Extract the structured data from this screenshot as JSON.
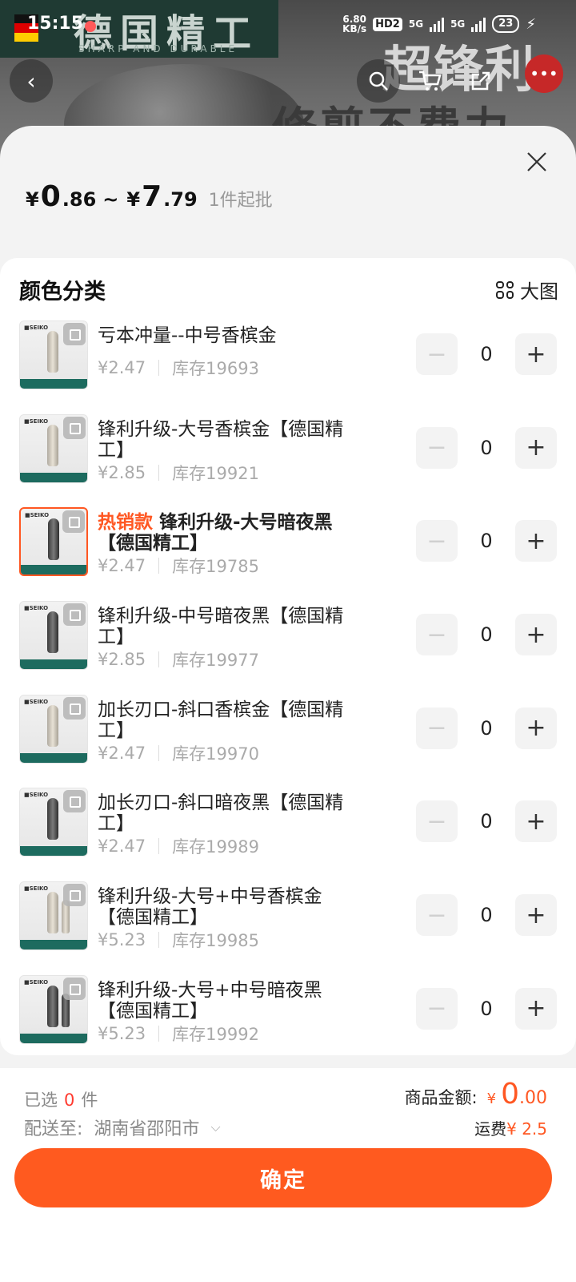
{
  "status_bar": {
    "time": "15:15",
    "net_speed_top": "6.80",
    "net_speed_bottom": "KB/s",
    "hd": "HD2",
    "sim1": "5G",
    "sim2": "5G",
    "battery": "23"
  },
  "background": {
    "banner_title": "德国精工",
    "banner_sub": "SHARP AND DURABLE",
    "big_text_1": "超锋利",
    "big_text_2": "修剪不费力"
  },
  "header": {
    "currency": "¥",
    "price_low_int": "0",
    "price_low_dec": ".86",
    "separator": "~",
    "price_high_int": "7",
    "price_high_dec": ".79",
    "min_order": "1件起批"
  },
  "panel": {
    "title": "颜色分类",
    "big_image_label": "大图"
  },
  "items": [
    {
      "name": "亏本冲量--中号香槟金",
      "hot": "",
      "price": "¥2.47",
      "stock": "库存19693",
      "qty": "0",
      "thumb": "gold"
    },
    {
      "name": "锋利升级-大号香槟金【德国精工】",
      "hot": "",
      "price": "¥2.85",
      "stock": "库存19921",
      "qty": "0",
      "thumb": "gold"
    },
    {
      "name": "锋利升级-大号暗夜黑【德国精工】",
      "hot": "热销款",
      "price": "¥2.47",
      "stock": "库存19785",
      "qty": "0",
      "thumb": "dark"
    },
    {
      "name": "锋利升级-中号暗夜黑【德国精工】",
      "hot": "",
      "price": "¥2.85",
      "stock": "库存19977",
      "qty": "0",
      "thumb": "dark"
    },
    {
      "name": "加长刃口-斜口香槟金【德国精工】",
      "hot": "",
      "price": "¥2.47",
      "stock": "库存19970",
      "qty": "0",
      "thumb": "gold"
    },
    {
      "name": "加长刃口-斜口暗夜黑【德国精工】",
      "hot": "",
      "price": "¥2.47",
      "stock": "库存19989",
      "qty": "0",
      "thumb": "dark"
    },
    {
      "name": "锋利升级-大号+中号香槟金【德国精工】",
      "hot": "",
      "price": "¥5.23",
      "stock": "库存19985",
      "qty": "0",
      "thumb": "gold"
    },
    {
      "name": "锋利升级-大号+中号暗夜黑【德国精工】",
      "hot": "",
      "price": "¥5.23",
      "stock": "库存19992",
      "qty": "0",
      "thumb": "dark"
    }
  ],
  "footer": {
    "selected_prefix": "已选",
    "selected_count": "0",
    "selected_unit": "件",
    "ship_label": "配送至:",
    "ship_location": "湖南省邵阳市",
    "amount_label": "商品金额:",
    "amount_currency": "¥",
    "amount_int": "0",
    "amount_dec": ".00",
    "freight_label": "运费",
    "freight_value": "¥ 2.5",
    "confirm_label": "确定"
  },
  "colors": {
    "accent": "#ff5a1f",
    "hot": "#ff5722",
    "price_red": "#ff3b30"
  }
}
